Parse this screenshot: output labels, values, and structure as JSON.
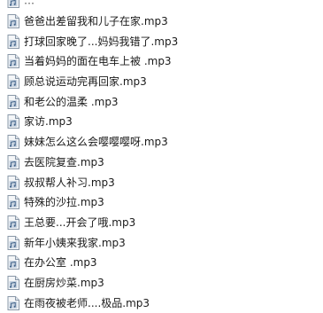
{
  "file_list": {
    "icon": "audio-file-icon",
    "items": [
      {
        "name": "…"
      },
      {
        "name": "爸爸出差留我和儿子在家.mp3"
      },
      {
        "name": "打球回家晚了...妈妈我错了.mp3"
      },
      {
        "name": "当着妈妈的面在电车上被      .mp3"
      },
      {
        "name": "顾总说运动完再回家.mp3"
      },
      {
        "name": "和老公的温柔     .mp3"
      },
      {
        "name": "家访.mp3"
      },
      {
        "name": "妹妹怎么这么会嘤嘤嘤呀.mp3"
      },
      {
        "name": "去医院复查.mp3"
      },
      {
        "name": "叔叔帮人补习.mp3"
      },
      {
        "name": "特殊的沙拉.mp3"
      },
      {
        "name": "王总要...开会了哦.mp3"
      },
      {
        "name": "新年小姨来我家.mp3"
      },
      {
        "name": "在办公室    .mp3"
      },
      {
        "name": "在厨房炒菜.mp3"
      },
      {
        "name": "在雨夜被老师....极品.mp3"
      }
    ]
  }
}
